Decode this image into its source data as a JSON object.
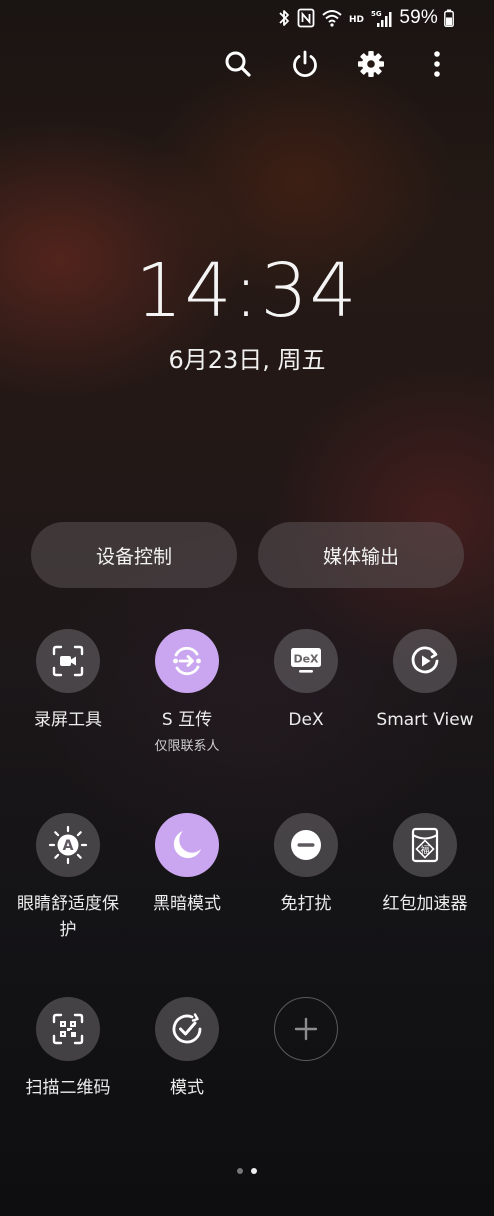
{
  "status_bar": {
    "battery_percent": "59%",
    "hd_label": "HD",
    "network_label": "5G",
    "icons": [
      "bluetooth-icon",
      "nfc-icon",
      "wifi-icon",
      "signal-icon",
      "battery-icon"
    ]
  },
  "top_actions": [
    "search-icon",
    "power-icon",
    "settings-icon",
    "more-icon"
  ],
  "clock": {
    "time": "14:34",
    "date": "6月23日, 周五"
  },
  "pills": {
    "device_control": "设备控制",
    "media_output": "媒体输出"
  },
  "tiles": [
    {
      "label": "录屏工具",
      "icon": "screen-record-icon",
      "active": false
    },
    {
      "label": "S 互传",
      "sublabel": "仅限联系人",
      "icon": "s-share-icon",
      "active": true
    },
    {
      "label": "DeX",
      "icon": "dex-icon",
      "icon_text": "DeX",
      "active": false
    },
    {
      "label": "Smart View",
      "icon": "smart-view-icon",
      "active": false
    },
    {
      "label": "眼睛舒适度保护",
      "icon": "eye-comfort-icon",
      "icon_text": "A",
      "active": false
    },
    {
      "label": "黑暗模式",
      "icon": "dark-mode-icon",
      "active": true
    },
    {
      "label": "免打扰",
      "icon": "do-not-disturb-icon",
      "active": false
    },
    {
      "label": "红包加速器",
      "icon": "red-envelope-icon",
      "icon_text": "福",
      "active": false
    },
    {
      "label": "扫描二维码",
      "icon": "qr-scan-icon",
      "active": false
    },
    {
      "label": "模式",
      "icon": "modes-icon",
      "active": false
    },
    {
      "label": "",
      "icon": "add-icon",
      "active": false
    }
  ],
  "page_indicator": {
    "pages": 2,
    "current": 2
  },
  "colors": {
    "active_tile": "#c9a6ef",
    "tile_bg": "#5e595e",
    "text": "#ffffff"
  }
}
